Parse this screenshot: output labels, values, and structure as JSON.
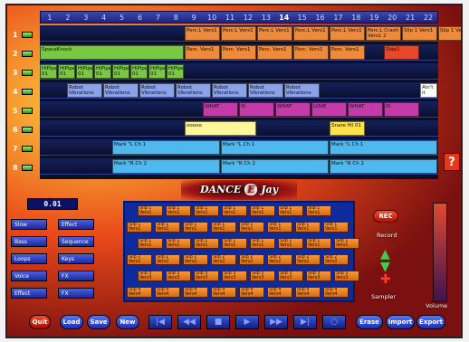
{
  "ruler": [
    "1",
    "2",
    "3",
    "4",
    "5",
    "6",
    "7",
    "8",
    "9",
    "10",
    "11",
    "12",
    "13",
    "14",
    "15",
    "16",
    "17",
    "18",
    "19",
    "20",
    "21",
    "22"
  ],
  "track_numbers": [
    "1",
    "2",
    "3",
    "4",
    "5",
    "6",
    "7",
    "8"
  ],
  "tracks": [
    {
      "clips": [
        {
          "label": "Perc.L Vers1",
          "color": "#ef8a3a"
        },
        {
          "label": "Perc.L Vers1",
          "color": "#ef8a3a"
        },
        {
          "label": "Perc.L Vers1",
          "color": "#ef8a3a"
        },
        {
          "label": "Perc.L Vers1",
          "color": "#ef8a3a"
        },
        {
          "label": "Perc.L Vers1",
          "color": "#ef8a3a"
        },
        {
          "label": "Perc.L Crash Vers1 2",
          "color": "#ef8a3a"
        },
        {
          "label": "Slip 1 Vers1",
          "color": "#ef8a3a"
        },
        {
          "label": "Slip 1 Vers1",
          "color": "#ef8a3a"
        }
      ]
    },
    {
      "clips": [
        {
          "label": "SpaceKnock",
          "color": "#78c843"
        },
        {
          "label": "Perc. Vers1",
          "color": "#ef8a3a"
        },
        {
          "label": "Perc. Vers1",
          "color": "#ef8a3a"
        },
        {
          "label": "Perc. Vers1",
          "color": "#ef8a3a"
        },
        {
          "label": "Perc. Vers1",
          "color": "#ef8a3a"
        },
        {
          "label": "Perc. Vers1",
          "color": "#ef8a3a"
        },
        {
          "label": "Slap1",
          "color": "#e8482a"
        }
      ]
    },
    {
      "clips": [
        {
          "label": "HiPipe 01",
          "color": "#78c843"
        },
        {
          "label": "HiPipe 01",
          "color": "#78c843"
        },
        {
          "label": "HiPipe 01",
          "color": "#78c843"
        },
        {
          "label": "HiPipe 01",
          "color": "#78c843"
        },
        {
          "label": "HiPipe 01",
          "color": "#78c843"
        },
        {
          "label": "HiPipe 01",
          "color": "#78c843"
        },
        {
          "label": "HiPipe 01",
          "color": "#78c843"
        },
        {
          "label": "HiPipe 01",
          "color": "#78c843"
        }
      ]
    },
    {
      "clips": [
        {
          "label": "Robot Vibrations",
          "color": "#8aa2e8"
        },
        {
          "label": "Robot Vibrations",
          "color": "#8aa2e8"
        },
        {
          "label": "Robot Vibrations",
          "color": "#8aa2e8"
        },
        {
          "label": "Robot Vibrations",
          "color": "#8aa2e8"
        },
        {
          "label": "Robot Vibrations",
          "color": "#8aa2e8"
        },
        {
          "label": "Robot Vibrations",
          "color": "#8aa2e8"
        },
        {
          "label": "Robot Vibrations",
          "color": "#8aa2e8"
        },
        {
          "label": "Ain't it",
          "color": "#ffffff"
        }
      ]
    },
    {
      "clips": [
        {
          "label": "WHAT",
          "color": "#c43aa8"
        },
        {
          "label": "IS",
          "color": "#c43aa8"
        },
        {
          "label": "WHAT",
          "color": "#c43aa8"
        },
        {
          "label": "LOVE",
          "color": "#c43aa8"
        },
        {
          "label": "WHAT",
          "color": "#c43aa8"
        },
        {
          "label": "IS",
          "color": "#c43aa8"
        }
      ]
    },
    {
      "clips": [
        {
          "label": "ooooo",
          "color": "#fff59a"
        },
        {
          "label": "Snare fill 01",
          "color": "#ffe24a"
        }
      ]
    },
    {
      "clips": [
        {
          "label": "Mark \"L Ch 1",
          "color": "#4fb8ee"
        },
        {
          "label": "Mark \"L Ch 1",
          "color": "#4fb8ee"
        },
        {
          "label": "Mark \"L Ch 1",
          "color": "#4fb8ee"
        }
      ]
    },
    {
      "clips": [
        {
          "label": "Mark \"R Ch 2",
          "color": "#4fb8ee"
        },
        {
          "label": "Mark \"R Ch 2",
          "color": "#4fb8ee"
        },
        {
          "label": "Mark \"R Ch 2",
          "color": "#4fb8ee"
        }
      ]
    }
  ],
  "help_button": "?",
  "logo": {
    "left": "DANCE",
    "badge": "E",
    "right": "Jay"
  },
  "counter": "0.01",
  "left_controls": [
    "Slow",
    "Effect",
    "Bass",
    "Sequence",
    "Loops",
    "Keys",
    "Voice",
    "FX",
    "Effect",
    "FX"
  ],
  "pad_keys": [
    "Slip 1 Vers1",
    "Slip 1 Vers1",
    "Slip 1 Vers1",
    "Slip 1 Vers1",
    "Slip 1 Vers1",
    "Slip 1 Vers1",
    "Slip 1 Vers1",
    "Slip 1 Vers1",
    "Slip 1 Vers1",
    "Slip 1 Vers1",
    "Slip 1 Vers1",
    "Slip 1 Vers1",
    "Slip 1 Vers1",
    "Slip 1 Vers1",
    "Slip 1 Vers1",
    "Slip 1 Vers1",
    "Slip 1 Vers1",
    "Slip 1 Vers1",
    "Slip 1 Vers1",
    "Slip 1 Vers1",
    "Slip 1 Vers1",
    "Slip 1 Vers1",
    "Slip 1 Vers1",
    "Slip 2 Vers2",
    "Slip 2 Vers2",
    "Slip 2 Vers2",
    "Slip 2 Vers2",
    "Slip 2 Vers2",
    "Slip 2 Vers2",
    "Slip 2 Vers2",
    "Slip 2 Vers2",
    "Slip 3 Vers3",
    "Slip 3 Vers3",
    "Slip 3 Vers3",
    "Slip 3 Vers3",
    "Slip 3 Vers3",
    "Slip 3 Vers3",
    "Slip 3 Vers3",
    "Slip 3 Vers3",
    "Slip 4 Vers4",
    "Slip 4 Vers4",
    "Slip 4 Vers4",
    "Slip 4 Vers4",
    "Slip 4 Vers4",
    "Slip 4 Vers4",
    "Slip 4 Vers4",
    "Slip 4 Vers4"
  ],
  "right": {
    "rec": "REC",
    "record": "Record",
    "sampler": "Sampler",
    "volume": "Volume"
  },
  "toolbar": {
    "quit": "Quit",
    "load": "Load",
    "save": "Save",
    "new": "New",
    "erase": "Erase",
    "import": "Import",
    "export": "Export"
  },
  "transport_icons": [
    "first-icon",
    "rewind-icon",
    "stop-icon",
    "play-icon",
    "fast-forward-icon",
    "last-icon",
    "loop-icon"
  ]
}
